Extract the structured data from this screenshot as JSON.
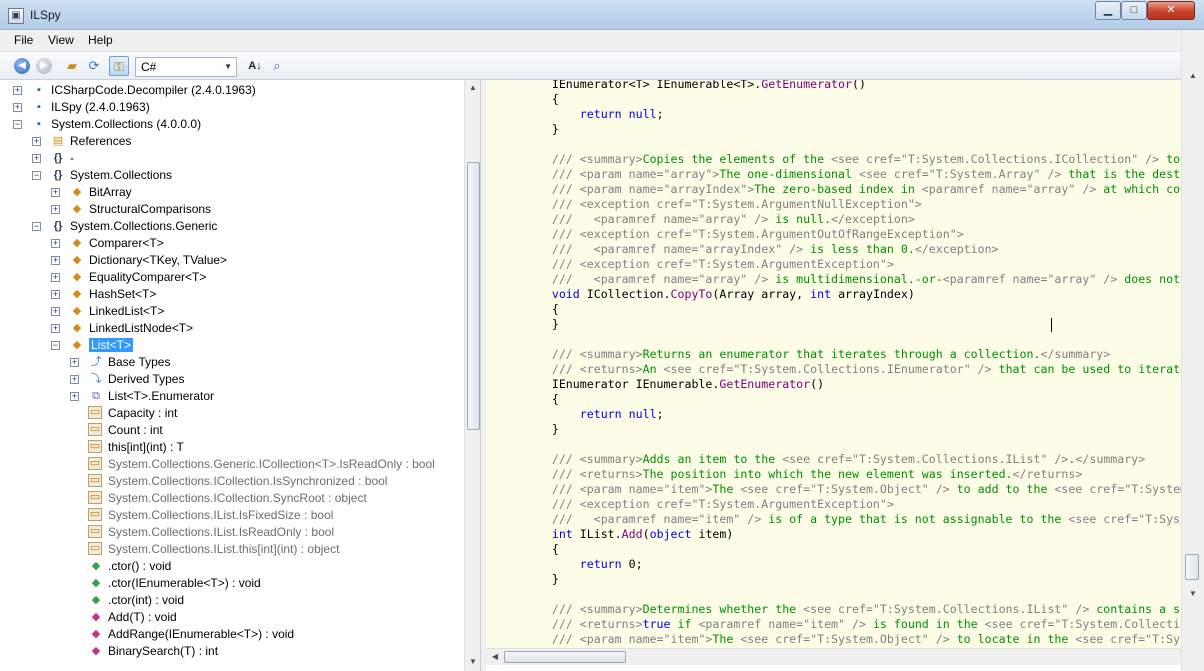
{
  "window": {
    "title": "ILSpy",
    "minimize_glyph": "▁",
    "maximize_glyph": "□",
    "close_glyph": "✕"
  },
  "menu": [
    {
      "label": "File"
    },
    {
      "label": "View"
    },
    {
      "label": "Help"
    }
  ],
  "toolbar": {
    "language": "C#",
    "icons": [
      "back-icon",
      "forward-icon",
      "open-icon",
      "reload-icon",
      "show-all-toggle-icon",
      "sort-icon",
      "search-icon"
    ]
  },
  "tree": [
    {
      "expander": "+",
      "icon": "assembly-icon",
      "glyph": "▪",
      "label": "ICSharpCode.Decompiler (2.4.0.1963)"
    },
    {
      "expander": "+",
      "icon": "assembly-icon",
      "glyph": "▪",
      "label": "ILSpy (2.4.0.1963)"
    },
    {
      "expander": "−",
      "icon": "assembly-icon",
      "glyph": "▪",
      "label": "System.Collections (4.0.0.0)"
    },
    {
      "expander": "+",
      "icon": "references-icon",
      "glyph": "▤",
      "label": "References"
    },
    {
      "expander": "+",
      "icon": "namespace-icon",
      "glyph": "{}",
      "label": "-"
    },
    {
      "expander": "−",
      "icon": "namespace-icon",
      "glyph": "{}",
      "label": "System.Collections"
    },
    {
      "expander": "+",
      "icon": "class-icon",
      "glyph": "◆",
      "label": "BitArray"
    },
    {
      "expander": "+",
      "icon": "static-class-icon",
      "glyph": "◆",
      "label": "StructuralComparisons"
    },
    {
      "expander": "−",
      "icon": "namespace-icon",
      "glyph": "{}",
      "label": "System.Collections.Generic"
    },
    {
      "expander": "+",
      "icon": "class-icon",
      "glyph": "◆",
      "label": "Comparer<T>"
    },
    {
      "expander": "+",
      "icon": "class-icon",
      "glyph": "◆",
      "label": "Dictionary<TKey, TValue>"
    },
    {
      "expander": "+",
      "icon": "class-icon",
      "glyph": "◆",
      "label": "EqualityComparer<T>"
    },
    {
      "expander": "+",
      "icon": "class-icon",
      "glyph": "◆",
      "label": "HashSet<T>"
    },
    {
      "expander": "+",
      "icon": "class-icon",
      "glyph": "◆",
      "label": "LinkedList<T>"
    },
    {
      "expander": "+",
      "icon": "class-icon",
      "glyph": "◆",
      "label": "LinkedListNode<T>"
    },
    {
      "expander": "−",
      "icon": "class-icon",
      "glyph": "◆",
      "label": "List<T>",
      "selected": true
    },
    {
      "expander": "+",
      "icon": "base-types-icon",
      "glyph": "⤴",
      "label": "Base Types"
    },
    {
      "expander": "+",
      "icon": "derived-types-icon",
      "glyph": "⤵",
      "label": "Derived Types"
    },
    {
      "expander": "+",
      "icon": "nested-struct-icon",
      "glyph": "⧉",
      "label": "List<T>.Enumerator"
    },
    {
      "expander": "",
      "icon": "property-icon",
      "glyph": "▭",
      "label": "Capacity : int"
    },
    {
      "expander": "",
      "icon": "property-icon",
      "glyph": "▭",
      "label": "Count : int"
    },
    {
      "expander": "",
      "icon": "property-icon",
      "glyph": "▭",
      "label": "this[int](int) : T"
    },
    {
      "expander": "",
      "icon": "private-property-icon",
      "glyph": "▭",
      "label": "System.Collections.Generic.ICollection<T>.IsReadOnly : bool",
      "gray": true
    },
    {
      "expander": "",
      "icon": "private-property-icon",
      "glyph": "▭",
      "label": "System.Collections.ICollection.IsSynchronized : bool",
      "gray": true
    },
    {
      "expander": "",
      "icon": "private-property-icon",
      "glyph": "▭",
      "label": "System.Collections.ICollection.SyncRoot : object",
      "gray": true
    },
    {
      "expander": "",
      "icon": "private-property-icon",
      "glyph": "▭",
      "label": "System.Collections.IList.IsFixedSize : bool",
      "gray": true
    },
    {
      "expander": "",
      "icon": "private-property-icon",
      "glyph": "▭",
      "label": "System.Collections.IList.IsReadOnly : bool",
      "gray": true
    },
    {
      "expander": "",
      "icon": "private-property-icon",
      "glyph": "▭",
      "label": "System.Collections.IList.this[int](int) : object",
      "gray": true
    },
    {
      "expander": "",
      "icon": "constructor-icon",
      "glyph": "◆",
      "label": ".ctor() : void"
    },
    {
      "expander": "",
      "icon": "constructor-icon",
      "glyph": "◆",
      "label": ".ctor(IEnumerable<T>) : void"
    },
    {
      "expander": "",
      "icon": "constructor-icon",
      "glyph": "◆",
      "label": ".ctor(int) : void"
    },
    {
      "expander": "",
      "icon": "method-icon",
      "glyph": "◆",
      "label": "Add(T) : void"
    },
    {
      "expander": "",
      "icon": "method-icon",
      "glyph": "◆",
      "label": "AddRange(IEnumerable<T>) : void"
    },
    {
      "expander": "",
      "icon": "method-icon",
      "glyph": "◆",
      "label": "BinarySearch(T) : int"
    }
  ],
  "code_lines": [
    [
      [
        "",
        "        IEnumerator<T> IEnumerable<T>."
      ],
      [
        "fn",
        "GetEnumerator"
      ],
      [
        "",
        "()"
      ]
    ],
    [
      [
        "",
        "        {"
      ]
    ],
    [
      [
        "",
        "            "
      ],
      [
        "kw",
        "return"
      ],
      [
        "kw",
        " null"
      ],
      [
        "",
        ";"
      ]
    ],
    [
      [
        "",
        "        }"
      ]
    ],
    [
      [
        "",
        ""
      ]
    ],
    [
      [
        "dg",
        "        /// <summary>"
      ],
      [
        "cm",
        "Copies the elements of the "
      ],
      [
        "dg",
        "<see cref=\"T:System.Collections.ICollection\" />"
      ],
      [
        "cm",
        " to an"
      ]
    ],
    [
      [
        "dg",
        "        /// <param name=\"array\">"
      ],
      [
        "cm",
        "The one-dimensional "
      ],
      [
        "dg",
        "<see cref=\"T:System.Array\" />"
      ],
      [
        "cm",
        " that is the destination"
      ]
    ],
    [
      [
        "dg",
        "        /// <param name=\"arrayIndex\">"
      ],
      [
        "cm",
        "The zero-based index in "
      ],
      [
        "dg",
        "<paramref name=\"array\" />"
      ],
      [
        "cm",
        " at which copying"
      ]
    ],
    [
      [
        "dg",
        "        /// <exception cref=\"T:System.ArgumentNullException\">"
      ]
    ],
    [
      [
        "dg",
        "        ///   <paramref name=\"array\" />"
      ],
      [
        "cm",
        " is null."
      ],
      [
        "dg",
        "</exception>"
      ]
    ],
    [
      [
        "dg",
        "        /// <exception cref=\"T:System.ArgumentOutOfRangeException\">"
      ]
    ],
    [
      [
        "dg",
        "        ///   <paramref name=\"arrayIndex\" />"
      ],
      [
        "cm",
        " is less than 0."
      ],
      [
        "dg",
        "</exception>"
      ]
    ],
    [
      [
        "dg",
        "        /// <exception cref=\"T:System.ArgumentException\">"
      ]
    ],
    [
      [
        "dg",
        "        ///   <paramref name=\"array\" />"
      ],
      [
        "cm",
        " is multidimensional.-or-"
      ],
      [
        "dg",
        "<paramref name=\"array\" />"
      ],
      [
        "cm",
        " does not hav"
      ]
    ],
    [
      [
        "kw",
        "        void"
      ],
      [
        "",
        " ICollection."
      ],
      [
        "fn",
        "CopyTo"
      ],
      [
        "",
        "(Array array, "
      ],
      [
        "kw",
        "int"
      ],
      [
        "",
        " arrayIndex)"
      ]
    ],
    [
      [
        "",
        "        {"
      ]
    ],
    [
      [
        "",
        "        }"
      ]
    ],
    [
      [
        "",
        ""
      ]
    ],
    [
      [
        "dg",
        "        /// <summary>"
      ],
      [
        "cm",
        "Returns an enumerator that iterates through a collection."
      ],
      [
        "dg",
        "</summary>"
      ]
    ],
    [
      [
        "dg",
        "        /// <returns>"
      ],
      [
        "cm",
        "An "
      ],
      [
        "dg",
        "<see cref=\"T:System.Collections.IEnumerator\" />"
      ],
      [
        "cm",
        " that can be used to iterate th"
      ]
    ],
    [
      [
        "",
        "        IEnumerator IEnumerable."
      ],
      [
        "fn",
        "GetEnumerator"
      ],
      [
        "",
        "()"
      ]
    ],
    [
      [
        "",
        "        {"
      ]
    ],
    [
      [
        "",
        "            "
      ],
      [
        "kw",
        "return"
      ],
      [
        "kw",
        " null"
      ],
      [
        "",
        ";"
      ]
    ],
    [
      [
        "",
        "        }"
      ]
    ],
    [
      [
        "",
        ""
      ]
    ],
    [
      [
        "dg",
        "        /// <summary>"
      ],
      [
        "cm",
        "Adds an item to the "
      ],
      [
        "dg",
        "<see cref=\"T:System.Collections.IList\" />"
      ],
      [
        "cm",
        "."
      ],
      [
        "dg",
        "</summary>"
      ]
    ],
    [
      [
        "dg",
        "        /// <returns>"
      ],
      [
        "cm",
        "The position into which the new element was inserted."
      ],
      [
        "dg",
        "</returns>"
      ]
    ],
    [
      [
        "dg",
        "        /// <param name=\"item\">"
      ],
      [
        "cm",
        "The "
      ],
      [
        "dg",
        "<see cref=\"T:System.Object\" />"
      ],
      [
        "cm",
        " to add to the "
      ],
      [
        "dg",
        "<see cref=\"T:System.Collect"
      ]
    ],
    [
      [
        "dg",
        "        /// <exception cref=\"T:System.ArgumentException\">"
      ]
    ],
    [
      [
        "dg",
        "        ///   <paramref name=\"item\" />"
      ],
      [
        "cm",
        " is of a type that is not assignable to the "
      ],
      [
        "dg",
        "<see cref=\"T:System.Co"
      ]
    ],
    [
      [
        "kw",
        "        int"
      ],
      [
        "",
        " IList."
      ],
      [
        "fn",
        "Add"
      ],
      [
        "",
        "("
      ],
      [
        "kw",
        "object"
      ],
      [
        "",
        " item)"
      ]
    ],
    [
      [
        "",
        "        {"
      ]
    ],
    [
      [
        "",
        "            "
      ],
      [
        "kw",
        "return"
      ],
      [
        "",
        " 0;"
      ]
    ],
    [
      [
        "",
        "        }"
      ]
    ],
    [
      [
        "",
        ""
      ]
    ],
    [
      [
        "dg",
        "        /// <summary>"
      ],
      [
        "cm",
        "Determines whether the "
      ],
      [
        "dg",
        "<see cref=\"T:System.Collections.IList\" />"
      ],
      [
        "cm",
        " contains a spe"
      ]
    ],
    [
      [
        "dg",
        "        /// <returns>"
      ],
      [
        "kw",
        "true"
      ],
      [
        "cm",
        " if "
      ],
      [
        "dg",
        "<paramref name=\"item\" />"
      ],
      [
        "cm",
        " is found in the "
      ],
      [
        "dg",
        "<see cref=\"T:System.Collections."
      ]
    ],
    [
      [
        "dg",
        "        /// <param name=\"item\">"
      ],
      [
        "cm",
        "The "
      ],
      [
        "dg",
        "<see cref=\"T:System.Object\" />"
      ],
      [
        "cm",
        " to locate in the "
      ],
      [
        "dg",
        "<see cref=\"T:System.Co"
      ]
    ]
  ]
}
